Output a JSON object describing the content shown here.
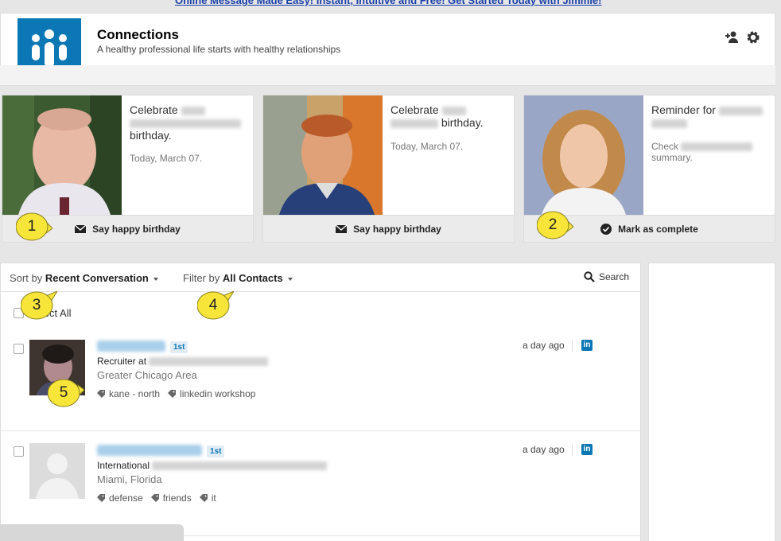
{
  "top_banner": {
    "text": "Online Message Made Easy! Instant, Intuitive and Free! Get Started Today with Jimmie!"
  },
  "header": {
    "title": "Connections",
    "tagline": "A healthy professional life starts with healthy relationships",
    "icons": [
      "add-contact-icon",
      "gear-icon"
    ]
  },
  "cards": [
    {
      "prefix": "Celebrate",
      "suffix": "birthday.",
      "date": "Today, March 07.",
      "action": "Say happy birthday",
      "action_icon": "envelope-icon"
    },
    {
      "prefix": "Celebrate",
      "suffix": "birthday.",
      "date": "Today, March 07.",
      "action": "Say happy birthday",
      "action_icon": "envelope-icon"
    },
    {
      "prefix": "Reminder for",
      "sub_prefix": "Check",
      "sub_suffix": "summary.",
      "action": "Mark as complete",
      "action_icon": "check-circle-icon"
    }
  ],
  "toolbar": {
    "sort_label": "Sort by",
    "sort_value": "Recent Conversation",
    "filter_label": "Filter by",
    "filter_value": "All Contacts",
    "search_label": "Search",
    "select_all_label": "Select All"
  },
  "contacts": [
    {
      "degree": "1st",
      "title_prefix": "Recruiter at",
      "location": "Greater Chicago Area",
      "tags": [
        "kane - north",
        "linkedin workshop"
      ],
      "time": "a day ago",
      "network": "in"
    },
    {
      "degree": "1st",
      "title_prefix": "International",
      "location": "Miami, Florida",
      "tags": [
        "defense",
        "friends",
        "it"
      ],
      "time": "a day ago",
      "network": "in"
    }
  ],
  "callouts": [
    "1",
    "2",
    "3",
    "4",
    "5"
  ],
  "colors": {
    "brand": "#0b77b5",
    "callout": "#f7e53a",
    "degree_bg": "#e2ecf4"
  }
}
